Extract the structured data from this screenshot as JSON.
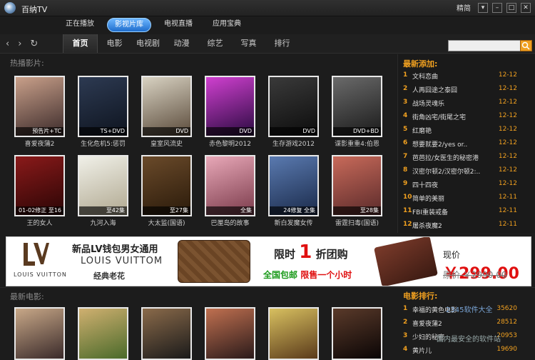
{
  "app": {
    "title": "百纳TV",
    "tb_text": "精简"
  },
  "main_tabs": [
    {
      "label": "正在播放"
    },
    {
      "label": "影视片库"
    },
    {
      "label": "电视直播"
    },
    {
      "label": "应用宝典"
    }
  ],
  "categories": [
    {
      "label": "首页"
    },
    {
      "label": "电影"
    },
    {
      "label": "电视剧"
    },
    {
      "label": "动漫"
    },
    {
      "label": "综艺"
    },
    {
      "label": "写真"
    },
    {
      "label": "排行"
    }
  ],
  "search": {
    "placeholder": ""
  },
  "hot": {
    "heading": "热播影片:",
    "items": [
      {
        "title": "喜爱夜蒲2",
        "badge": "预告片+TC",
        "c1": "#c9a08a",
        "c2": "#3b2a2a"
      },
      {
        "title": "生化危机5:惩罚",
        "badge": "TS+DVD",
        "c1": "#2d3a52",
        "c2": "#0e141f"
      },
      {
        "title": "皇室风流史",
        "badge": "DVD",
        "c1": "#d8d2c2",
        "c2": "#5a4a3a"
      },
      {
        "title": "赤色黎明2012",
        "badge": "DVD",
        "c1": "#d040d0",
        "c2": "#2a0a40"
      },
      {
        "title": "生存游戏2012",
        "badge": "DVD",
        "c1": "#3a3a3a",
        "c2": "#0c0c0c"
      },
      {
        "title": "谍影重重4:伯恩",
        "badge": "DVD+BD",
        "c1": "#6a6a6a",
        "c2": "#1a1a1a"
      },
      {
        "title": "王的女人",
        "badge": "01-02修正 至16",
        "c1": "#8a1a1a",
        "c2": "#2a0505"
      },
      {
        "title": "九河入海",
        "badge": "至42集",
        "c1": "#f0f0e8",
        "c2": "#b0a890"
      },
      {
        "title": "大太监(国语)",
        "badge": "至27集",
        "c1": "#6a4a2a",
        "c2": "#2a1a0a"
      },
      {
        "title": "巴厘岛的故事",
        "badge": "全集",
        "c1": "#e8a8b8",
        "c2": "#7a3a4a"
      },
      {
        "title": "新白发魔女传",
        "badge": "24修复 全集",
        "c1": "#5a7ab0",
        "c2": "#1a2a4a"
      },
      {
        "title": "雷霆扫毒(国语)",
        "badge": "至28集",
        "c1": "#c86a5a",
        "c2": "#5a2a2a"
      }
    ]
  },
  "latest": {
    "heading": "最新添加:",
    "items": [
      {
        "num": "1",
        "title": "文科恋曲",
        "date": "12-12"
      },
      {
        "num": "2",
        "title": "人再囧途之泰囧",
        "date": "12-12"
      },
      {
        "num": "3",
        "title": "战场灵魂乐",
        "date": "12-12"
      },
      {
        "num": "4",
        "title": "街角凶宅/街尾之宅",
        "date": "12-12"
      },
      {
        "num": "5",
        "title": "红磨艳",
        "date": "12-12"
      },
      {
        "num": "6",
        "title": "想要就要2/yes or..",
        "date": "12-12"
      },
      {
        "num": "7",
        "title": "芭芭拉/女医生的秘密港",
        "date": "12-12"
      },
      {
        "num": "8",
        "title": "汉密尔顿2/汉密尔顿2:..",
        "date": "12-12"
      },
      {
        "num": "9",
        "title": "四十四夜",
        "date": "12-12"
      },
      {
        "num": "10",
        "title": "简单的美丽",
        "date": "12-11"
      },
      {
        "num": "11",
        "title": "FBI重装戒备",
        "date": "12-11"
      },
      {
        "num": "12",
        "title": "屠杀夜魔2",
        "date": "12-11"
      }
    ]
  },
  "banner": {
    "lv_name": "LOUIS VUITTON",
    "title": "新品LV钱包男女通用",
    "en": "LOUIS VUITTOM",
    "sub": "经典老花",
    "limit_a": "限时",
    "limit_big": "1",
    "limit_b": "折团购",
    "ship_a": "全国包邮",
    "ship_b": "限售一个小时",
    "price_label": "现价",
    "price_value": "￥299.00",
    "old_label": "原价",
    "old_value": "￥2990.00"
  },
  "newmovies": {
    "heading": "最新电影:",
    "items": [
      {
        "c1": "#c8a888",
        "c2": "#3a2a2a"
      },
      {
        "c1": "#d0b070",
        "c2": "#4a6a2a"
      },
      {
        "c1": "#8a6a4a",
        "c2": "#1a1a1a"
      },
      {
        "c1": "#c07050",
        "c2": "#2a1a1a"
      },
      {
        "c1": "#d8c060",
        "c2": "#5a3a1a"
      },
      {
        "c1": "#5a3a2a",
        "c2": "#0a0505"
      }
    ]
  },
  "ranking": {
    "heading": "电影排行:",
    "items": [
      {
        "num": "1",
        "title": "幸福的黄色电影",
        "count": "35620"
      },
      {
        "num": "2",
        "title": "喜爱夜蒲2",
        "count": "28512"
      },
      {
        "num": "3",
        "title": "少妇的秘密",
        "count": "20953"
      },
      {
        "num": "4",
        "title": "黄片儿",
        "count": "19690"
      }
    ]
  },
  "watermark": {
    "a": "2345软件大全",
    "b": "国内最安全的软件站"
  }
}
